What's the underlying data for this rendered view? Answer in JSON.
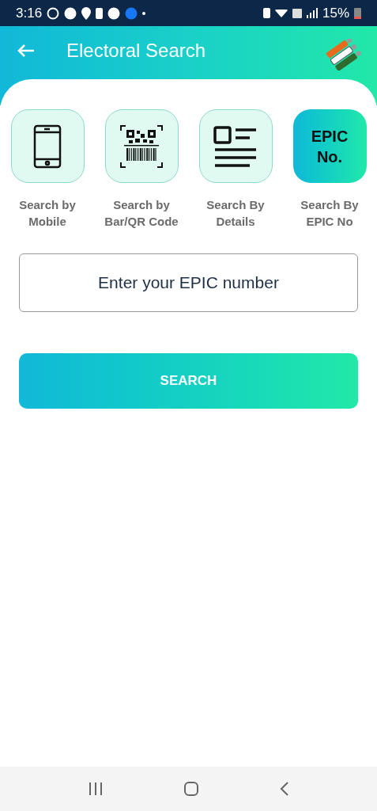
{
  "status_bar": {
    "time": "3:16",
    "battery": "15%"
  },
  "header": {
    "title": "Electoral Search"
  },
  "options": [
    {
      "kind": "mobile",
      "label": "Search by Mobile",
      "selected": false
    },
    {
      "kind": "qr",
      "label": "Search by Bar/QR Code",
      "selected": false
    },
    {
      "kind": "details",
      "label": "Search By Details",
      "selected": false
    },
    {
      "kind": "text",
      "tile_text": "EPIC No.",
      "label": "Search By EPIC No",
      "selected": true
    }
  ],
  "epic_field": {
    "placeholder": "Enter your EPIC number"
  },
  "search_button": "SEARCH"
}
